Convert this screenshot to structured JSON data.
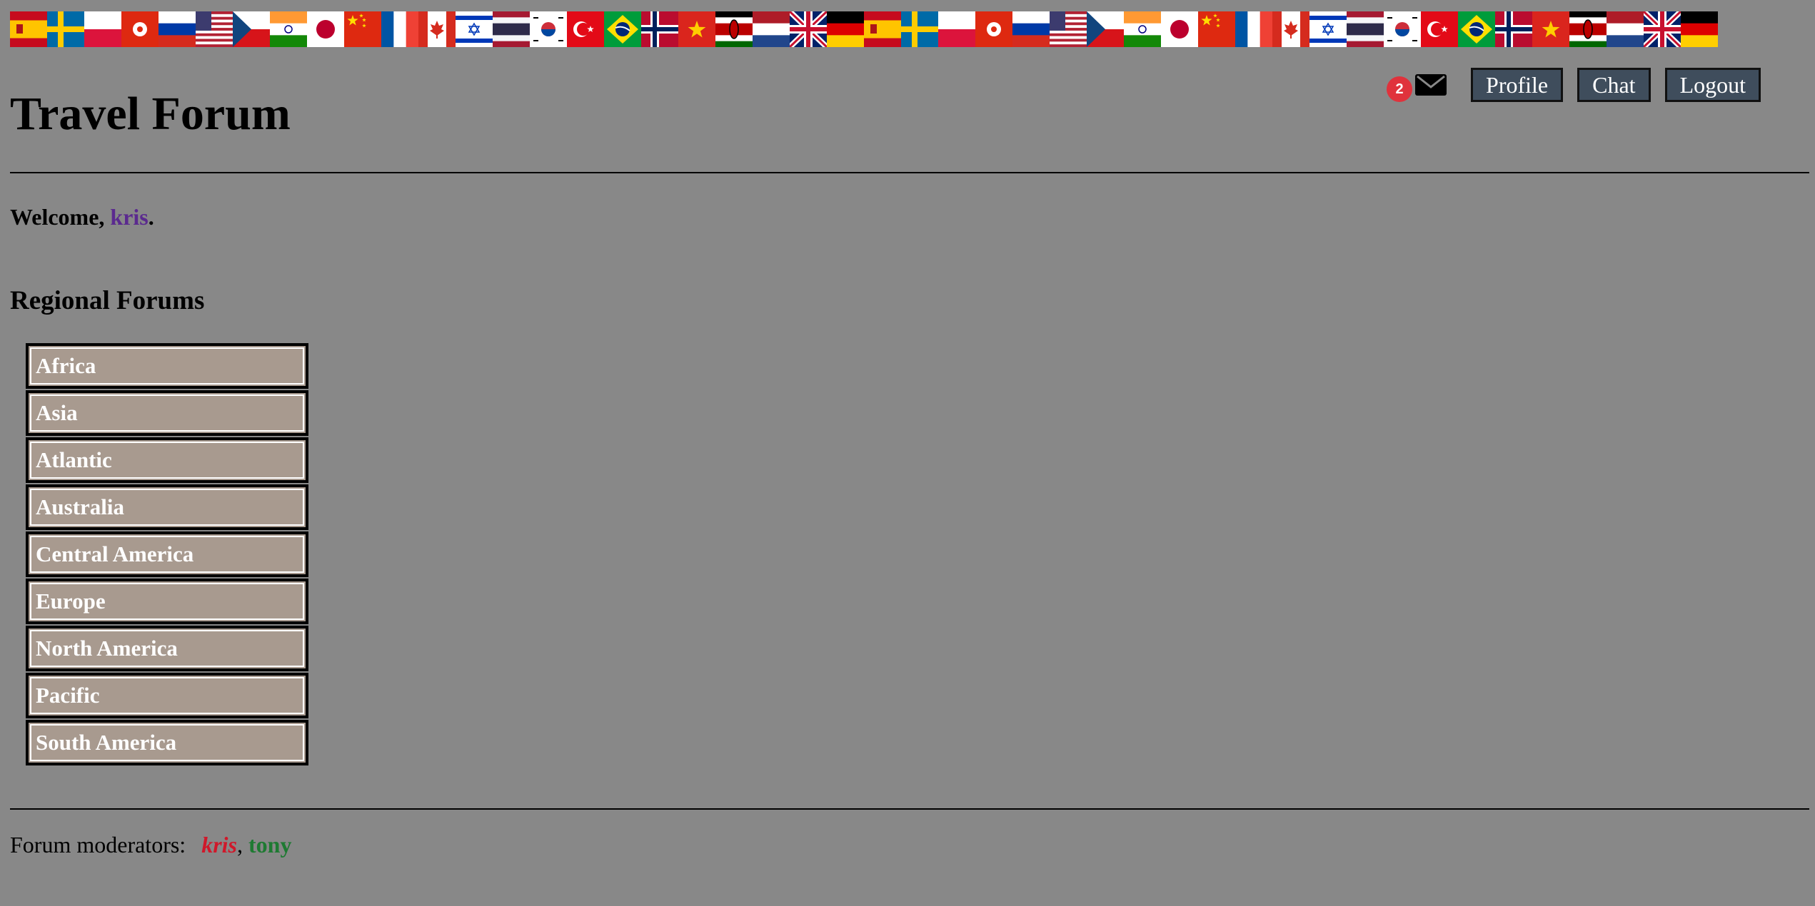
{
  "flags": [
    "es",
    "se",
    "pl",
    "hk",
    "ru",
    "us",
    "cz",
    "in",
    "jp",
    "cn",
    "fr",
    "ca",
    "il",
    "th",
    "kr",
    "tr",
    "br",
    "no",
    "vn",
    "ke",
    "nl",
    "gb",
    "de",
    "es",
    "se",
    "pl",
    "hk",
    "ru",
    "us",
    "cz",
    "in",
    "jp",
    "cn",
    "fr",
    "ca",
    "il",
    "th",
    "kr",
    "tr",
    "br",
    "no",
    "vn",
    "ke",
    "nl",
    "gb",
    "de"
  ],
  "nav": {
    "unread_count": "2",
    "mail_icon": "envelope-icon",
    "profile_label": "Profile",
    "chat_label": "Chat",
    "logout_label": "Logout"
  },
  "page_title": "Travel Forum",
  "welcome": {
    "prefix": "Welcome, ",
    "username": "kris",
    "suffix": "."
  },
  "section_heading": "Regional Forums",
  "forums": [
    "Africa",
    "Asia",
    "Atlantic",
    "Australia",
    "Central America",
    "Europe",
    "North America",
    "Pacific",
    "South America"
  ],
  "moderators": {
    "label": "Forum moderators:",
    "users": [
      "kris",
      "tony"
    ],
    "separator": ", "
  },
  "colors": {
    "background": "#888888",
    "forum_button": "#a89a8f",
    "nav_button": "#3f4d5c",
    "badge": "#e0323c",
    "welcome_user": "#5b2a8f",
    "moderator_1": "#d0182a",
    "moderator_2": "#1e7a32"
  }
}
